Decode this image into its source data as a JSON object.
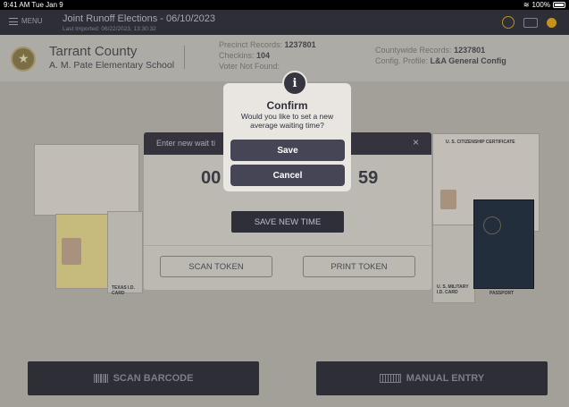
{
  "status_bar": {
    "time": "9:41 AM  Tue Jan 9",
    "battery": "100%"
  },
  "header": {
    "menu_label": "MENU",
    "election_title": "Joint Runoff Elections - 06/10/2023",
    "last_imported": "Last Imported: 06/22/2023, 13:30:32"
  },
  "info": {
    "county": "Tarrant County",
    "school": "A. M. Pate Elementary School",
    "precinct_label": "Precinct Records:",
    "precinct_value": "1237801",
    "checkins_label": "Checkins:",
    "checkins_value": "104",
    "voter_not_found": "Voter Not Found:",
    "countywide_label": "Countywide Records:",
    "countywide_value": "1237801",
    "config_label": "Config. Profile:",
    "config_value": "L&A General Config"
  },
  "cards": {
    "citizenship": "U. S. CITIZENSHIP CERTIFICATE",
    "military": "U. S. MILITARY I.D. CARD",
    "passport": "PASSPORT",
    "voter_card": "TEXAS I.D. CARD"
  },
  "bottom": {
    "scan_barcode": "SCAN BARCODE",
    "manual_entry": "MANUAL ENTRY"
  },
  "wait_panel": {
    "title": "Enter new wait ti",
    "close": "×",
    "digits_left": "00",
    "digits_right": "59",
    "save_new_time": "SAVE NEW TIME",
    "scan_token": "SCAN TOKEN",
    "print_token": "PRINT TOKEN"
  },
  "confirm": {
    "icon": "i",
    "title": "Confirm",
    "message": "Would you like to set a new average waiting time?",
    "save": "Save",
    "cancel": "Cancel"
  }
}
